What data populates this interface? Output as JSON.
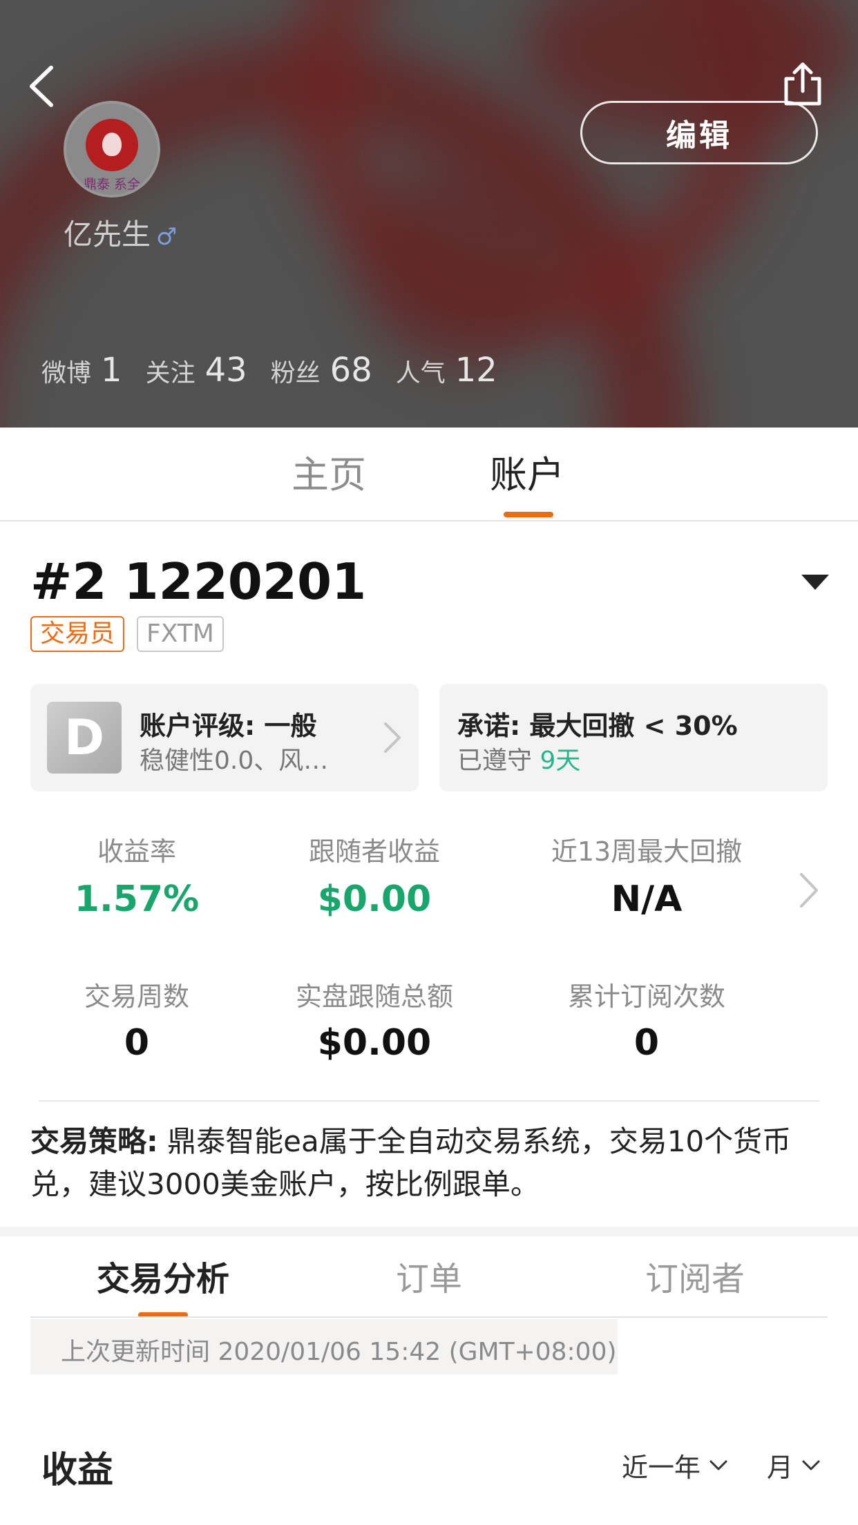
{
  "header": {
    "edit_label": "编辑",
    "username": "亿先生",
    "gender_symbol": "♂",
    "avatar_seal_text": "鼎泰 系全",
    "stats": [
      {
        "label": "微博",
        "value": "1"
      },
      {
        "label": "关注",
        "value": "43"
      },
      {
        "label": "粉丝",
        "value": "68"
      },
      {
        "label": "人气",
        "value": "12"
      }
    ]
  },
  "main_tabs": [
    {
      "label": "主页",
      "active": false
    },
    {
      "label": "账户",
      "active": true
    }
  ],
  "account": {
    "id": "#2 1220201",
    "tags": [
      "交易员",
      "FXTM"
    ],
    "rating_card": {
      "grade": "D",
      "title": "账户评级: 一般",
      "subtitle": "稳健性0.0、风…"
    },
    "promise_card": {
      "title": "承诺: 最大回撤 < 30%",
      "status_prefix": "已遵守",
      "days": "9天"
    },
    "metrics": [
      {
        "label": "收益率",
        "value": "1.57%",
        "color": "#18a66d"
      },
      {
        "label": "跟随者收益",
        "value": "$0.00",
        "color": "#18a66d"
      },
      {
        "label": "近13周最大回撤",
        "value": "N/A",
        "color": "#111111"
      },
      {
        "label": "交易周数",
        "value": "0",
        "color": "#111111"
      },
      {
        "label": "实盘跟随总额",
        "value": "$0.00",
        "color": "#111111"
      },
      {
        "label": "累计订阅次数",
        "value": "0",
        "color": "#111111"
      }
    ],
    "strategy_label": "交易策略:",
    "strategy_text": " 鼎泰智能ea属于全自动交易系统，交易10个货币兑，建议3000美金账户，按比例跟单。"
  },
  "sub_tabs": [
    {
      "label": "交易分析",
      "active": true
    },
    {
      "label": "订单",
      "active": false
    },
    {
      "label": "订阅者",
      "active": false
    }
  ],
  "update_text": "上次更新时间 2020/01/06 15:42 (GMT+08:00)",
  "earnings": {
    "title": "收益",
    "range_filter": "近一年",
    "period_filter": "月"
  },
  "colors": {
    "accent": "#f06a12",
    "positive": "#18a66d",
    "teal": "#25b68b"
  }
}
